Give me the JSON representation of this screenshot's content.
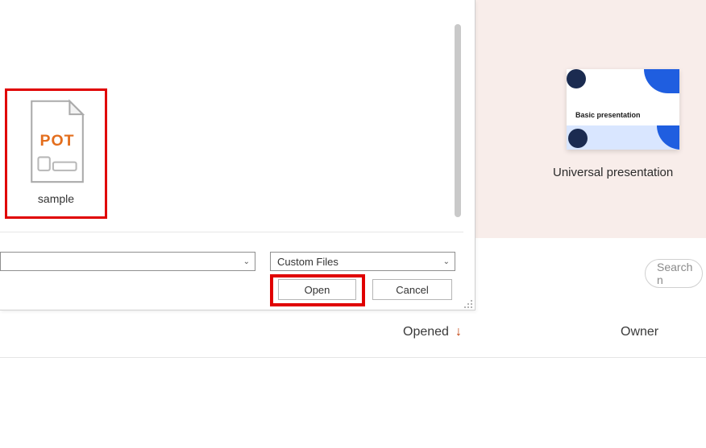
{
  "app": {
    "template": {
      "inner_title": "Basic presentation",
      "label": "Universal presentation"
    },
    "columns": {
      "opened_label": "Opened",
      "owner_label": "Owner"
    },
    "search_placeholder": "Search n"
  },
  "dialog": {
    "file": {
      "name": "sample",
      "icon_text": "POT",
      "highlighted": true
    },
    "filename_value": "",
    "filetype_label": "Custom Files",
    "buttons": {
      "open": "Open",
      "cancel": "Cancel"
    }
  },
  "colors": {
    "highlight": "#e00000",
    "accent_orange": "#e36e1d"
  }
}
